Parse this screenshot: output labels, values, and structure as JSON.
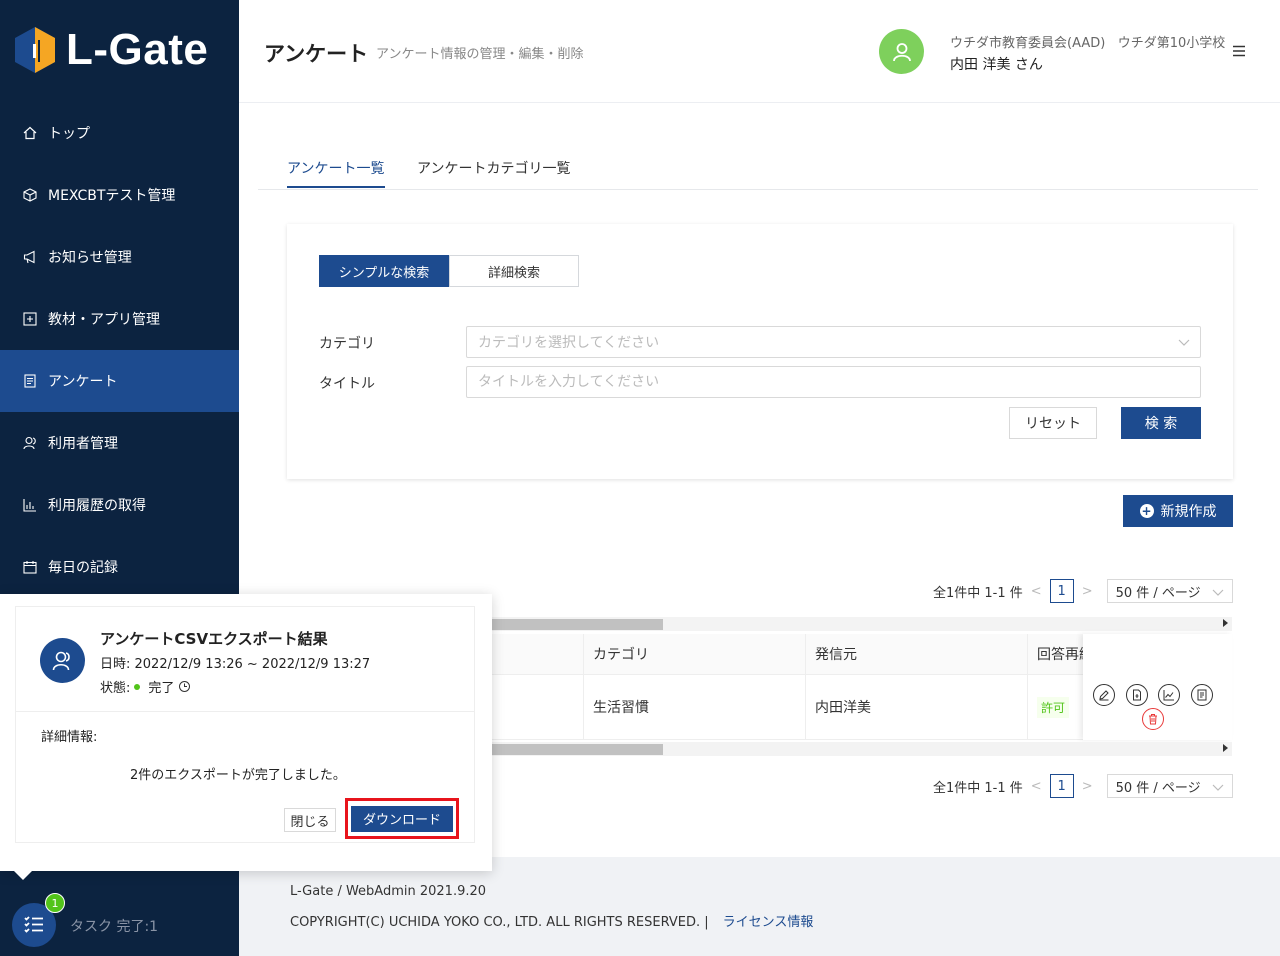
{
  "app": {
    "logo_text": "L-Gate"
  },
  "sidebar": {
    "items": [
      {
        "label": "トップ",
        "icon": "home-icon"
      },
      {
        "label": "MEXCBTテスト管理",
        "icon": "cube-icon"
      },
      {
        "label": "お知らせ管理",
        "icon": "megaphone-icon"
      },
      {
        "label": "教材・アプリ管理",
        "icon": "plus-square-icon"
      },
      {
        "label": "アンケート",
        "icon": "survey-icon",
        "active": true
      },
      {
        "label": "利用者管理",
        "icon": "users-icon"
      },
      {
        "label": "利用履歴の取得",
        "icon": "bar-chart-icon"
      },
      {
        "label": "毎日の記録",
        "icon": "calendar-icon"
      }
    ]
  },
  "header": {
    "title": "アンケート",
    "subtitle": "アンケート情報の管理・編集・削除",
    "org": "ウチダ市教育委員会(AAD)   ウチダ第10小学校",
    "user": "内田 洋美 さん"
  },
  "tabs": [
    {
      "label": "アンケート一覧",
      "active": true
    },
    {
      "label": "アンケートカテゴリ一覧",
      "active": false
    }
  ],
  "search": {
    "mode_simple": "シンプルな検索",
    "mode_detail": "詳細検索",
    "category_label": "カテゴリ",
    "category_placeholder": "カテゴリを選択してください",
    "title_label": "タイトル",
    "title_placeholder": "タイトルを入力してください",
    "reset": "リセット",
    "submit": "検 索"
  },
  "new_button": "新規作成",
  "pagination": {
    "summary": "全1件中 1-1 件",
    "current_page": "1",
    "page_size": "50 件 / ページ"
  },
  "table": {
    "columns": [
      "カテゴリ",
      "発信元",
      "回答再編"
    ],
    "rows": [
      {
        "category": "生活習慣",
        "sender": "内田洋美",
        "reanswer": "許可"
      }
    ]
  },
  "notification": {
    "title": "アンケートCSVエクスポート結果",
    "time": "日時: 2022/12/9 13:26 ~ 2022/12/9 13:27",
    "status_label": "状態:",
    "status_value": "完了",
    "detail_label": "詳細情報:",
    "message": "2件のエクスポートが完了しました。",
    "close": "閉じる",
    "download": "ダウンロード"
  },
  "task": {
    "badge": "1",
    "label": "タスク 完了:1"
  },
  "footer": {
    "version": "L-Gate / WebAdmin 2021.9.20",
    "copyright": "COPYRIGHT(C) UCHIDA YOKO CO., LTD. ALL RIGHTS RESERVED. |",
    "license": "ライセンス情報"
  },
  "colors": {
    "sidebar_bg": "#0c2340",
    "primary": "#1d4b8f",
    "success": "#52c41a",
    "highlight": "#e8141c"
  }
}
